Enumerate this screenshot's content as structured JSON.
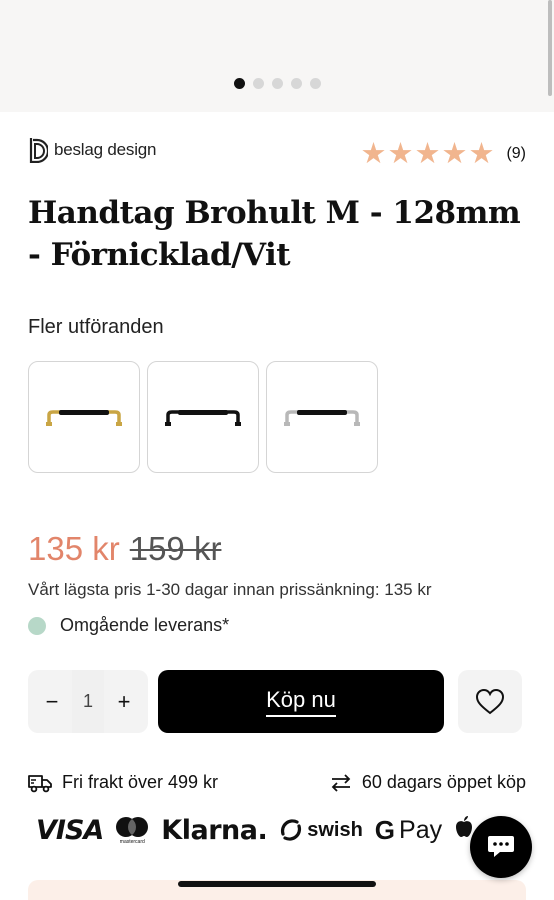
{
  "gallery": {
    "dot_count": 5,
    "active_index": 0
  },
  "brand": {
    "name": "beslag design",
    "icon": "beslag-design-logo"
  },
  "rating": {
    "value": 5,
    "max": 5,
    "count_label": "(9)",
    "star_color": "#f1b58e"
  },
  "product": {
    "title": "Handtag Brohult M - 128mm - Förnicklad/Vit"
  },
  "variants": {
    "label": "Fler utföranden",
    "items": [
      {
        "name": "handle-black-brass",
        "end_color": "#c9a544"
      },
      {
        "name": "handle-black",
        "end_color": "#111111"
      },
      {
        "name": "handle-black-nickel",
        "end_color": "#b8b8b8"
      }
    ]
  },
  "price": {
    "current": "135 kr",
    "original": "159 kr",
    "note": "Vårt lägsta pris 1-30 dagar innan prissänkning: 135 kr",
    "sale_color": "#e2856a"
  },
  "delivery": {
    "text": "Omgående leverans*",
    "dot_color": "#b7d8c8"
  },
  "cart": {
    "quantity": "1",
    "minus_label": "−",
    "plus_label": "+",
    "buy_label": "Köp nu",
    "wishlist_icon": "heart-icon"
  },
  "usps": {
    "shipping": {
      "icon": "truck-icon",
      "text": "Fri frakt över 499 kr"
    },
    "returns": {
      "icon": "arrows-exchange-icon",
      "text": "60 dagars öppet köp"
    }
  },
  "payments": {
    "visa": "VISA",
    "mastercard": "mastercard",
    "klarna": "Klarna.",
    "swish": "swish",
    "google_pay_g": "G",
    "google_pay": "Pay",
    "apple_pay": ""
  },
  "chat": {
    "icon": "chat-bubble-icon"
  }
}
